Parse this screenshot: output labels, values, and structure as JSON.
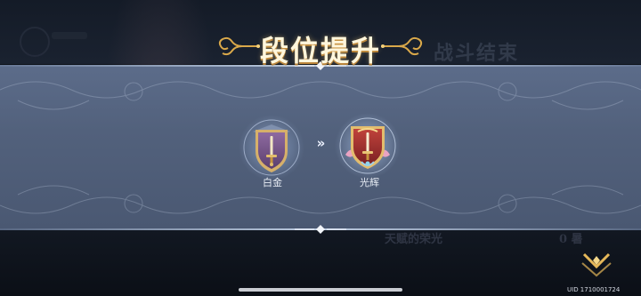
{
  "title": "段位提升",
  "promotion": {
    "from_rank": "白金",
    "to_rank": "光辉",
    "arrow_glyph": "»"
  },
  "background": {
    "title_behind": "战斗结束",
    "line_behind": "天赋的荣光",
    "count_behind": "0 暑"
  },
  "uid_label": "UID 1710001724",
  "icons": {
    "old_emblem": "platinum-sword-shield-icon",
    "new_emblem": "radiance-sword-shield-icon",
    "confirm": "chevron-down-confirm-icon"
  },
  "colors": {
    "band": "#55647f",
    "title": "#fff6dc",
    "gold_accent": "#d9a84a",
    "platinum_shield": "#7b5a8c",
    "radiance_shield": "#a8342f"
  }
}
